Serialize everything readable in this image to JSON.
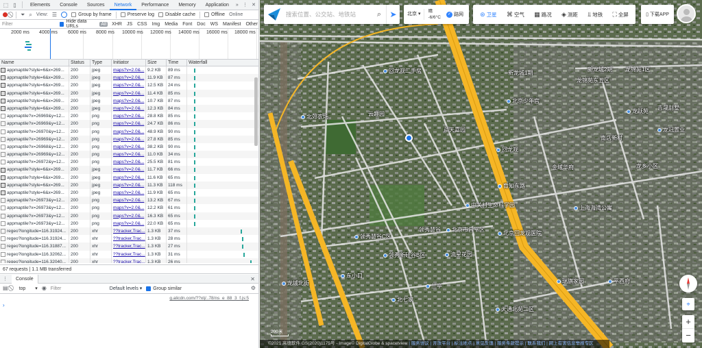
{
  "devtools": {
    "tabs": [
      "Elements",
      "Console",
      "Sources",
      "Network",
      "Performance",
      "Memory",
      "Application"
    ],
    "active_tab": "Network",
    "more": "»",
    "toolbar": {
      "view_label": "View:",
      "group_by_frame": "Group by frame",
      "preserve_log": "Preserve log",
      "disable_cache": "Disable cache",
      "offline": "Offline",
      "online": "Online"
    },
    "filter": {
      "placeholder": "Filter",
      "hide_data_urls": "Hide data URLs",
      "types": [
        "All",
        "XHR",
        "JS",
        "CSS",
        "Img",
        "Media",
        "Font",
        "Doc",
        "WS",
        "Manifest",
        "Other"
      ]
    },
    "timeline_ticks": [
      "2000 ms",
      "4000 ms",
      "6000 ms",
      "8000 ms",
      "10000 ms",
      "12000 ms",
      "14000 ms",
      "16000 ms",
      "18000 ms"
    ],
    "columns": [
      "Name",
      "Status",
      "Type",
      "Initiator",
      "Size",
      "Time",
      "Waterfall"
    ],
    "rows": [
      {
        "name": "appmaptile?style=6&x=269...",
        "status": "200",
        "type": "jpeg",
        "initiator": "maps?v=2.0&...",
        "size": "9.2 KB",
        "time": "89 ms"
      },
      {
        "name": "appmaptile?style=6&x=269...",
        "status": "200",
        "type": "jpeg",
        "initiator": "maps?v=2.0&...",
        "size": "11.9 KB",
        "time": "87 ms"
      },
      {
        "name": "appmaptile?style=6&x=269...",
        "status": "200",
        "type": "jpeg",
        "initiator": "maps?v=2.0&...",
        "size": "12.5 KB",
        "time": "24 ms"
      },
      {
        "name": "appmaptile?style=6&x=269...",
        "status": "200",
        "type": "jpeg",
        "initiator": "maps?v=2.0&...",
        "size": "11.4 KB",
        "time": "85 ms"
      },
      {
        "name": "appmaptile?style=6&x=269...",
        "status": "200",
        "type": "jpeg",
        "initiator": "maps?v=2.0&...",
        "size": "10.7 KB",
        "time": "87 ms"
      },
      {
        "name": "appmaptile?style=6&x=269...",
        "status": "200",
        "type": "jpeg",
        "initiator": "maps?v=2.0&...",
        "size": "12.3 KB",
        "time": "84 ms"
      },
      {
        "name": "appmaptile?x=26969&y=12...",
        "status": "200",
        "type": "png",
        "initiator": "maps?v=2.0&...",
        "size": "28.8 KB",
        "time": "85 ms"
      },
      {
        "name": "appmaptile?x=26969&y=12...",
        "status": "200",
        "type": "png",
        "initiator": "maps?v=2.0&...",
        "size": "24.7 KB",
        "time": "86 ms"
      },
      {
        "name": "appmaptile?x=26970&y=12...",
        "status": "200",
        "type": "png",
        "initiator": "maps?v=2.0&...",
        "size": "48.9 KB",
        "time": "90 ms"
      },
      {
        "name": "appmaptile?x=26969&y=12...",
        "status": "200",
        "type": "png",
        "initiator": "maps?v=2.0&...",
        "size": "27.8 KB",
        "time": "85 ms"
      },
      {
        "name": "appmaptile?x=26968&y=12...",
        "status": "200",
        "type": "png",
        "initiator": "maps?v=2.0&...",
        "size": "38.2 KB",
        "time": "90 ms"
      },
      {
        "name": "appmaptile?x=26969&y=12...",
        "status": "200",
        "type": "png",
        "initiator": "maps?v=2.0&...",
        "size": "11.0 KB",
        "time": "34 ms"
      },
      {
        "name": "appmaptile?x=26972&y=12...",
        "status": "200",
        "type": "png",
        "initiator": "maps?v=2.0&...",
        "size": "25.5 KB",
        "time": "81 ms"
      },
      {
        "name": "appmaptile?style=6&x=269...",
        "status": "200",
        "type": "jpeg",
        "initiator": "maps?v=2.0&...",
        "size": "11.7 KB",
        "time": "66 ms"
      },
      {
        "name": "appmaptile?style=6&x=269...",
        "status": "200",
        "type": "jpeg",
        "initiator": "maps?v=2.0&...",
        "size": "11.6 KB",
        "time": "65 ms"
      },
      {
        "name": "appmaptile?style=6&x=269...",
        "status": "200",
        "type": "jpeg",
        "initiator": "maps?v=2.0&...",
        "size": "11.3 KB",
        "time": "118 ms"
      },
      {
        "name": "appmaptile?style=6&x=269...",
        "status": "200",
        "type": "jpeg",
        "initiator": "maps?v=2.0&...",
        "size": "11.9 KB",
        "time": "65 ms"
      },
      {
        "name": "appmaptile?x=26973&y=12...",
        "status": "200",
        "type": "png",
        "initiator": "maps?v=2.0&...",
        "size": "13.2 KB",
        "time": "67 ms"
      },
      {
        "name": "appmaptile?x=26973&y=12...",
        "status": "200",
        "type": "png",
        "initiator": "maps?v=2.0&...",
        "size": "12.2 KB",
        "time": "61 ms"
      },
      {
        "name": "appmaptile?x=26973&y=12...",
        "status": "200",
        "type": "png",
        "initiator": "maps?v=2.0&...",
        "size": "16.3 KB",
        "time": "65 ms"
      },
      {
        "name": "appmaptile?x=26973&y=12...",
        "status": "200",
        "type": "png",
        "initiator": "maps?v=2.0&...",
        "size": "22.0 KB",
        "time": "65 ms"
      },
      {
        "name": "regeo?longitude=116.31924...",
        "status": "200",
        "type": "xhr",
        "initiator": "??tracker,Trac...",
        "size": "1.3 KB",
        "time": "37 ms"
      },
      {
        "name": "regeo?longitude=116.31924...",
        "status": "200",
        "type": "xhr",
        "initiator": "??tracker,Trac...",
        "size": "1.3 KB",
        "time": "28 ms"
      },
      {
        "name": "regeo?longitude=116.31887...",
        "status": "200",
        "type": "xhr",
        "initiator": "??tracker,Trac...",
        "size": "1.3 KB",
        "time": "27 ms"
      },
      {
        "name": "regeo?longitude=116.32062...",
        "status": "200",
        "type": "xhr",
        "initiator": "??tracker,Trac...",
        "size": "1.3 KB",
        "time": "31 ms"
      },
      {
        "name": "regeo?longitude=116.32040...",
        "status": "200",
        "type": "xhr",
        "initiator": "??tracker,Trac...",
        "size": "1.3 KB",
        "time": "26 ms"
      }
    ],
    "status_bar": "67 requests  |  1.1 MB transferred",
    "console": {
      "tab": "Console",
      "context": "top",
      "filter_placeholder": "Filter",
      "levels": "Default levels ▾",
      "group_similar": "Group similar",
      "link": "g.alicdn.com/??xlj/..78/ns_e_88_3_f.js:5",
      "prompt": "›"
    }
  },
  "map": {
    "search_placeholder": "搜索位置、公交站、地铁站",
    "city": "北京",
    "weather_text": "晴",
    "weather_temp": "-6/6°C",
    "road_label": "路网",
    "tools": [
      "卫星",
      "空气",
      "路况",
      "测距",
      "地铁",
      "全屏"
    ],
    "active_tool": "卫星",
    "download": "下载APP",
    "scale_label": "200米",
    "copyright_prefix": "©2021 高德软件 GS(2020)1175号 - Image© DigitalGlobe & spacetview",
    "copyright_links": [
      "| 服务协议",
      "| 开放平台",
      "| 标注地点",
      "| 意见反馈",
      "| 服务条款提示",
      "| 联系我们",
      "| 网上有害信息举报专区"
    ],
    "labels": [
      {
        "text": "新龙城1期",
        "dot": false
      },
      {
        "text": "新龙城2期",
        "dot": false
      },
      {
        "text": "龙锦苑1区",
        "dot": false
      },
      {
        "text": "龙锦苑东五区",
        "dot": false
      },
      {
        "text": "回龙观二手房",
        "dot": true
      },
      {
        "text": "北京少年宫",
        "dot": true
      },
      {
        "text": "吉晟别墅",
        "dot": false
      },
      {
        "text": "云趣园",
        "dot": false
      },
      {
        "text": "龙跃苑",
        "dot": true
      },
      {
        "text": "北郊农场",
        "dot": true
      },
      {
        "text": "蓝天嘉园",
        "dot": false
      },
      {
        "text": "回龙观",
        "dot": true
      },
      {
        "text": "南店新村",
        "dot": false
      },
      {
        "text": "龙冠置业",
        "dot": true
      },
      {
        "text": "金域华府",
        "dot": false
      },
      {
        "text": "龙乡小区",
        "dot": false
      },
      {
        "text": "育知东路",
        "dot": true
      },
      {
        "text": "中关村生命科学园",
        "dot": true
      },
      {
        "text": "北京市昌平区",
        "dot": true
      },
      {
        "text": "上海海湾公寓",
        "dot": true
      },
      {
        "text": "领秀慧谷",
        "dot": false
      },
      {
        "text": "领秀慧谷C区",
        "dot": true
      },
      {
        "text": "北京回龙观医院",
        "dot": true
      },
      {
        "text": "领秀新硅谷B区",
        "dot": true
      },
      {
        "text": "流星花园",
        "dot": true
      },
      {
        "text": "东小口",
        "dot": true
      },
      {
        "text": "龙域北街",
        "dot": true
      },
      {
        "text": "兰亭",
        "dot": true
      },
      {
        "text": "瑞旗家园",
        "dot": true
      },
      {
        "text": "平西府",
        "dot": true
      },
      {
        "text": "北七家",
        "dot": true
      },
      {
        "text": "天通北苑二区",
        "dot": true
      }
    ]
  },
  "colors": {
    "devtools_accent": "#1a73e8",
    "record_red": "#d93025",
    "highway_yellow": "#f5b626",
    "road_white": "#e8e8e8",
    "map_blue": "#3385ff"
  }
}
